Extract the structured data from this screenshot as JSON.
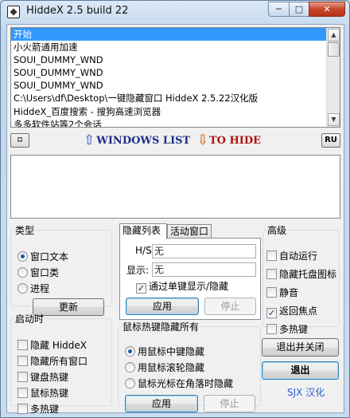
{
  "window": {
    "title": "HiddeX 2.5 build 22",
    "minimize_glyph": "─",
    "maximize_glyph": "□",
    "close_glyph": "✕"
  },
  "window_list": {
    "items": [
      "开始",
      "小火箭通用加速",
      "SOUI_DUMMY_WND",
      "SOUI_DUMMY_WND",
      "SOUI_DUMMY_WND",
      "C:\\Users\\df\\Desktop\\一键隐藏窗口 HiddeX 2.5.22汉化版",
      "HiddeX_百度搜索 - 搜狗高速浏览器",
      "多多软件站等2个会话"
    ],
    "selected_index": 0
  },
  "midbar": {
    "pin_label": "⌑",
    "windows_list_label": "WINDOWS LIST",
    "to_hide_label": "TO HIDE",
    "ru_label": "RU"
  },
  "type_group": {
    "legend": "类型",
    "options": [
      "窗口文本",
      "窗口类",
      "进程"
    ],
    "selected": 0,
    "refresh_label": "更新"
  },
  "startup_group": {
    "legend": "启动时",
    "items": [
      {
        "label": "隐藏 HiddeX",
        "checked": false
      },
      {
        "label": "隐藏所有窗口",
        "checked": false
      },
      {
        "label": "键盘热键",
        "checked": false
      },
      {
        "label": "鼠标热键",
        "checked": false
      },
      {
        "label": "多热键",
        "checked": false
      }
    ]
  },
  "tabs": {
    "items": [
      "隐藏列表",
      "活动窗口"
    ],
    "active": 0,
    "hs_label": "H/S:",
    "hs_value": "无",
    "display_label": "显示:",
    "display_value": "无",
    "single_key_label": "通过单键显示/隐藏",
    "single_key_checked": true,
    "apply_label": "应用",
    "stop_label": "停止"
  },
  "mouse_group": {
    "legend": "鼠标热键隐藏所有",
    "options": [
      "用鼠标中键隐藏",
      "用鼠标滚轮隐藏",
      "鼠标光标在角落时隐藏"
    ],
    "selected": 0,
    "apply_label": "应用",
    "stop_label": "停止"
  },
  "advanced_group": {
    "legend": "高级",
    "items": [
      {
        "label": "自动运行",
        "checked": false
      },
      {
        "label": "隐藏托盘图标",
        "checked": false
      },
      {
        "label": "静音",
        "checked": false
      },
      {
        "label": "返回焦点",
        "checked": true
      },
      {
        "label": "多热键",
        "checked": false
      }
    ]
  },
  "actions": {
    "exit_close_label": "退出并关闭",
    "exit_label": "退出",
    "credit": "SJX 汉化"
  },
  "colors": {
    "selection": "#3399ff",
    "title_windows": "#1f2e8a",
    "title_hide": "#b01010",
    "credit": "#2a5bd7"
  }
}
